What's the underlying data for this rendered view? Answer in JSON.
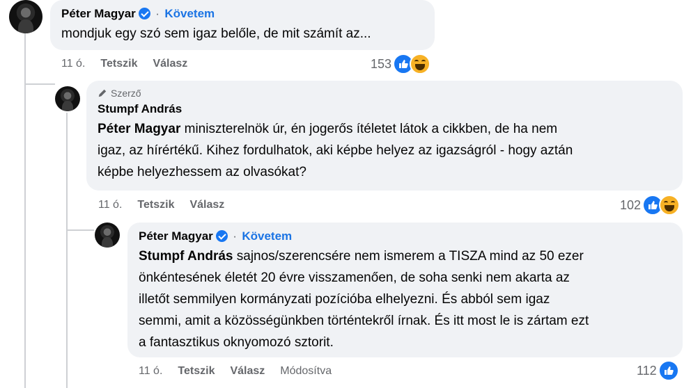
{
  "comments": [
    {
      "author": "Péter Magyar",
      "follow": "Követem",
      "text_lines": [
        "mondjuk egy szó sem igaz belőle, de mit számít az..."
      ],
      "time": "11 ó.",
      "like": "Tetszik",
      "reply": "Válasz",
      "reaction_count": "153",
      "reactions": [
        "like-icon",
        "haha-icon"
      ]
    },
    {
      "author_tag": "Szerző",
      "author": "Stumpf András",
      "mention": "Péter Magyar",
      "text_line1_rest": " miniszterelnök úr, én jogerős ítéletet látok a cikkben, de ha nem",
      "text_line2": "igaz, az hírértékű. Kihez fordulhatok, aki képbe helyez az igazságról - hogy aztán",
      "text_line3": "képbe helyezhessem az olvasókat?",
      "time": "11 ó.",
      "like": "Tetszik",
      "reply": "Válasz",
      "reaction_count": "102",
      "reactions": [
        "like-icon",
        "haha-icon"
      ]
    },
    {
      "author": "Péter Magyar",
      "follow": "Követem",
      "mention": "Stumpf András",
      "text_line1_rest": " sajnos/szerencsére nem ismerem a TISZA mind az 50 ezer",
      "text_line2": "önkéntesének életét 20 évre visszamenően, de soha senki nem akarta az",
      "text_line3": "illetőt semmilyen kormányzati pozícióba elhelyezni. És abból sem igaz",
      "text_line4": "semmi, amit a közösségünkben történtekről írnak. És itt most le is zártam ezt",
      "text_line5": "a fantasztikus oknyomozó sztorit.",
      "time": "11 ó.",
      "like": "Tetszik",
      "reply": "Válasz",
      "edited": "Módosítva",
      "reaction_count": "112",
      "reactions": [
        "like-icon"
      ]
    }
  ],
  "dot": "·",
  "colors": {
    "link": "#1b74e4",
    "bubble": "#f0f2f5",
    "secondary": "#65676b",
    "like": "#1877f2",
    "haha": "#f7b125"
  }
}
